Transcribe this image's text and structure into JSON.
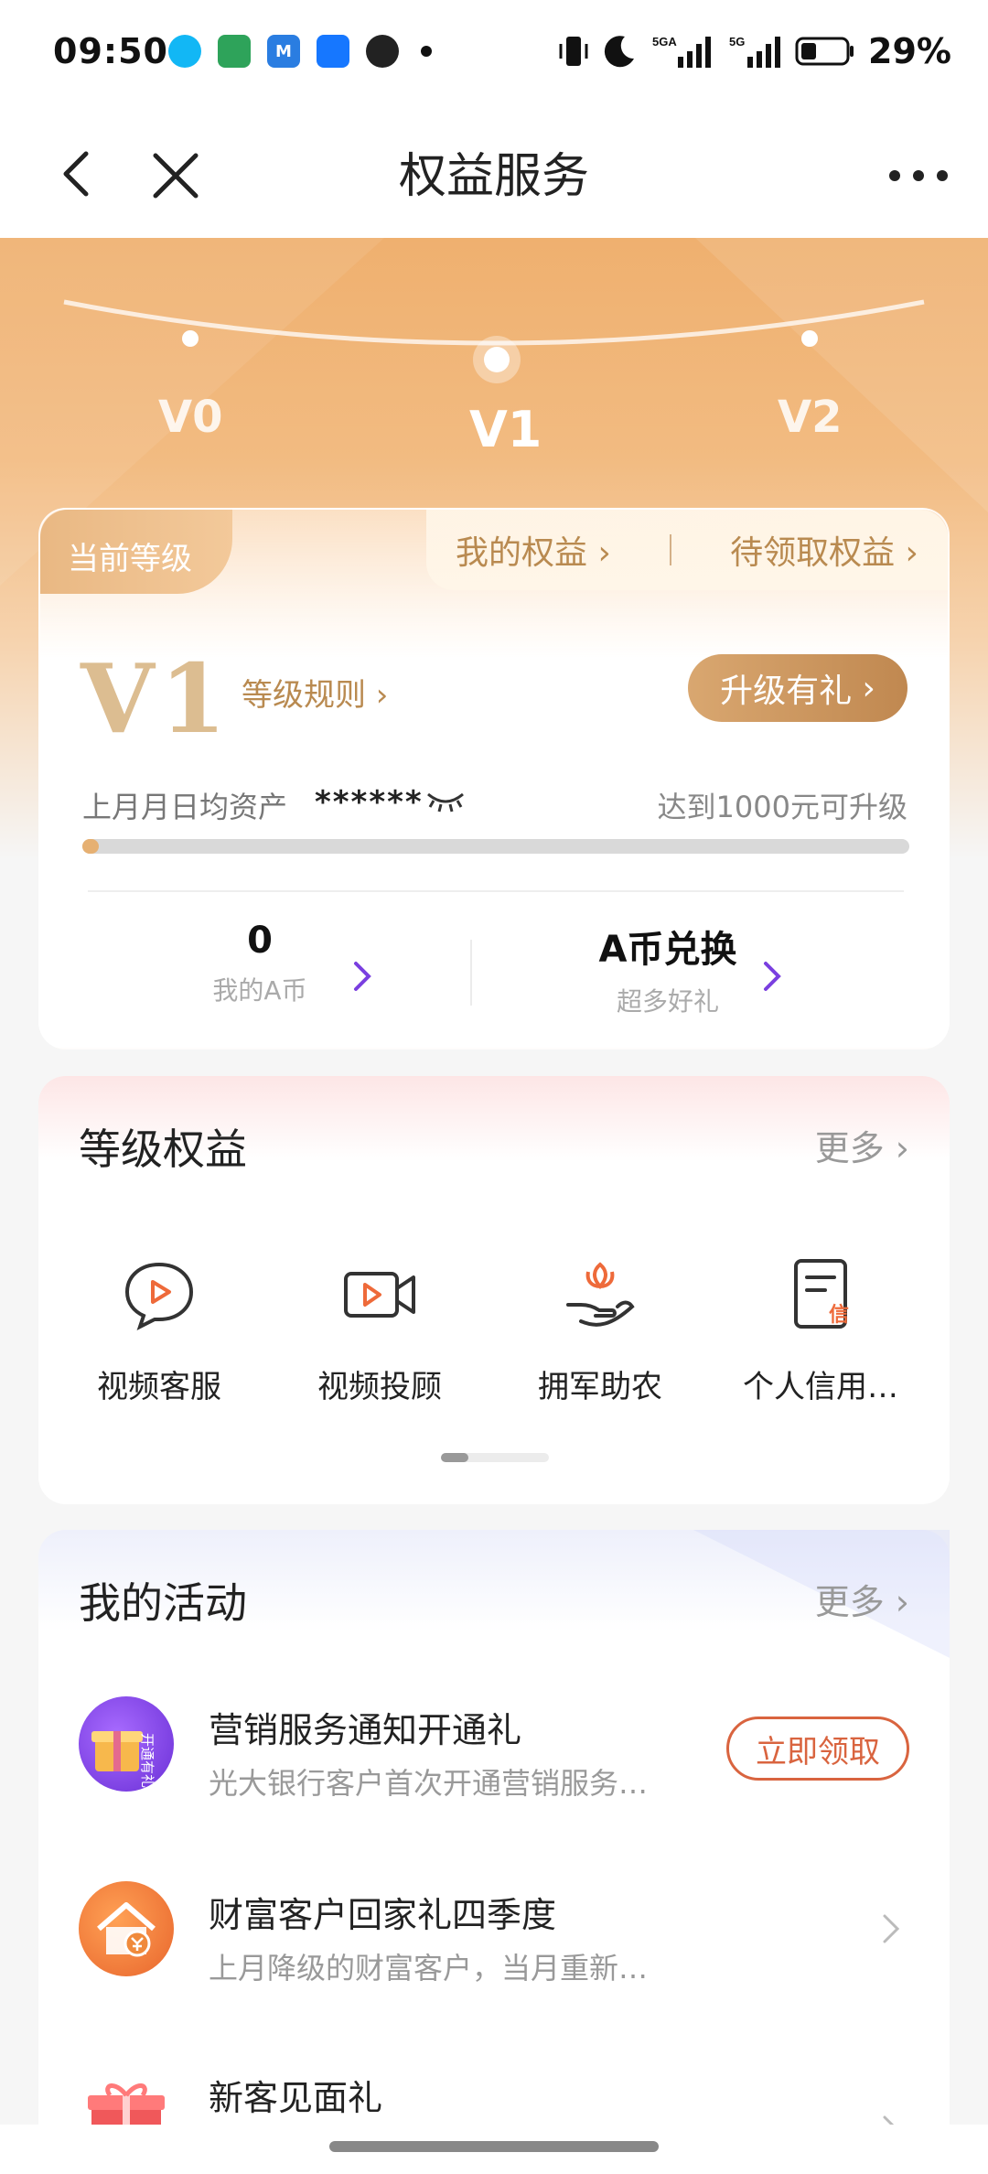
{
  "status_bar": {
    "time": "09:50",
    "battery": "29%",
    "apps": [
      {
        "icon": "qq-icon",
        "color": "#12b7f5"
      },
      {
        "icon": "oppo-app-icon",
        "color": "#2ea35a"
      },
      {
        "icon": "m-app-icon",
        "color": "#2a7de1"
      },
      {
        "icon": "alipay-icon",
        "color": "#1677ff"
      },
      {
        "icon": "wechat-icon",
        "color": "#222222"
      }
    ],
    "network_labels": [
      "5GA",
      "5G"
    ]
  },
  "nav": {
    "title": "权益服务"
  },
  "levels": [
    "V0",
    "V1",
    "V2"
  ],
  "level_card": {
    "current_tab": "当前等级",
    "my_benefits": "我的权益",
    "pending_benefits": "待领取权益",
    "level": "V1",
    "rules": "等级规则",
    "upgrade_button": "升级有礼",
    "asset_label": "上月月日均资产",
    "asset_value": "******",
    "upgrade_hint": "达到1000元可升级",
    "progress": 0.02,
    "coins": {
      "value": "0",
      "label": "我的A币"
    },
    "exchange": {
      "value": "A币兑换",
      "label": "超多好礼"
    }
  },
  "benefits": {
    "title": "等级权益",
    "more": "更多",
    "items": [
      {
        "label": "视频客服",
        "icon": "video-chat-icon"
      },
      {
        "label": "视频投顾",
        "icon": "video-camera-icon"
      },
      {
        "label": "拥军助农",
        "icon": "hand-flower-icon"
      },
      {
        "label": "个人信用…",
        "icon": "credit-document-icon",
        "badge": "信"
      }
    ]
  },
  "activities": {
    "title": "我的活动",
    "more": "更多",
    "items": [
      {
        "title": "营销服务通知开通礼",
        "desc": "光大银行客户首次开通营销服务…",
        "action": "立即领取",
        "avatar_text": "开通有礼",
        "color": "#7a3fe0"
      },
      {
        "title": "财富客户回家礼四季度",
        "desc": "上月降级的财富客户，当月重新…",
        "color": "#ee7d3a"
      },
      {
        "title": "新客见面礼",
        "desc": "",
        "color": "#f0585a"
      }
    ]
  },
  "colors": {
    "accent": "#c08850",
    "hero": "#efb06f",
    "claim": "#d9643f",
    "purple": "#7a3fe0"
  }
}
